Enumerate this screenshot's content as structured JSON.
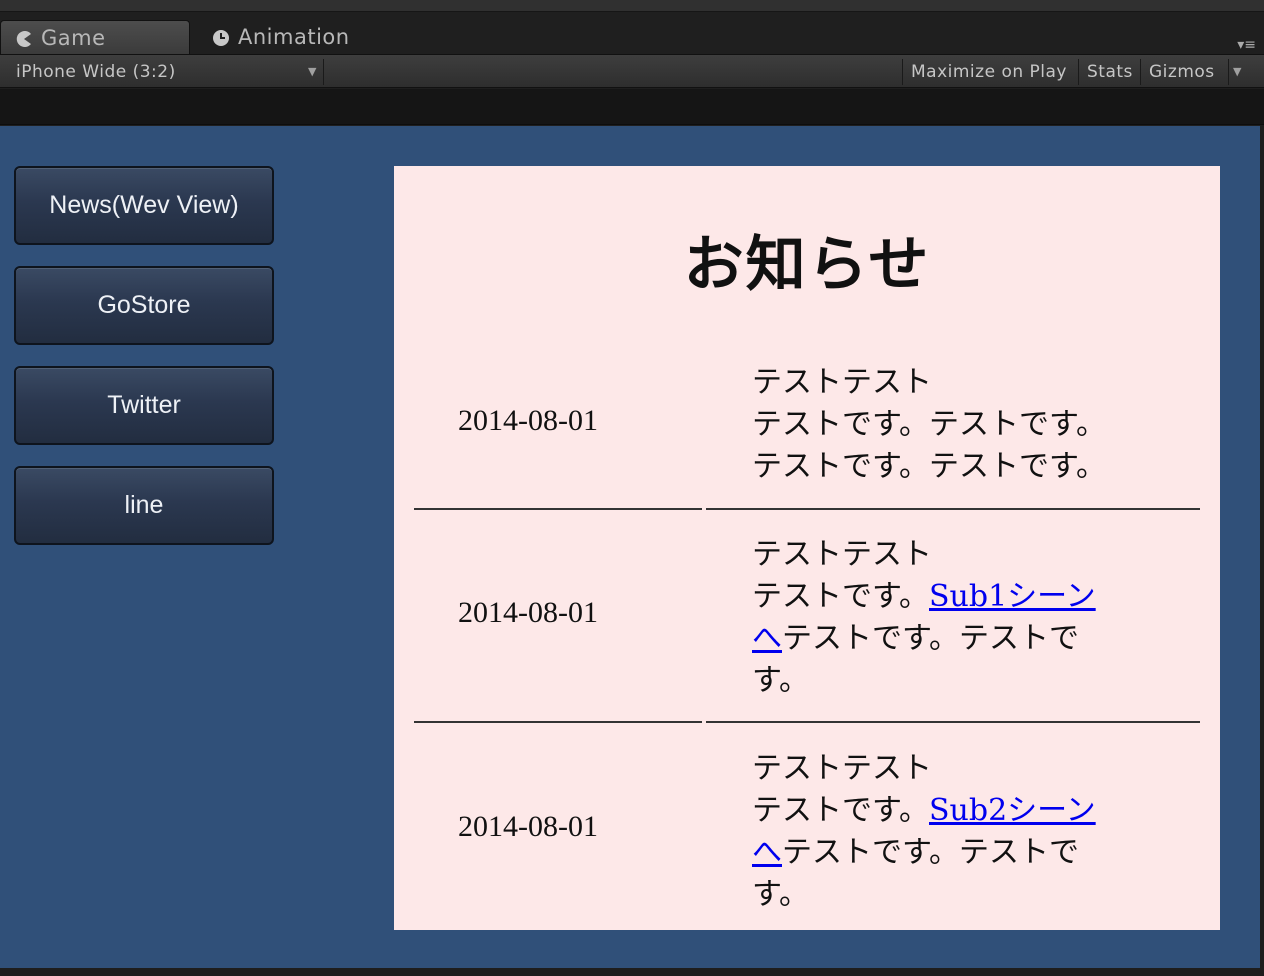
{
  "tabs": [
    {
      "label": "Game",
      "icon": "pacman-icon",
      "active": true
    },
    {
      "label": "Animation",
      "icon": "clock-icon",
      "active": false
    }
  ],
  "toolbar": {
    "aspect_label": "iPhone Wide (3:2)",
    "maximize_label": "Maximize on Play",
    "stats_label": "Stats",
    "gizmos_label": "Gizmos"
  },
  "game_buttons": [
    {
      "label": "News(Wev View)"
    },
    {
      "label": "GoStore"
    },
    {
      "label": "Twitter"
    },
    {
      "label": "line"
    }
  ],
  "webview": {
    "title": "お知らせ",
    "items": [
      {
        "date": "2014-08-01",
        "line1": "テストテスト",
        "line2": "テストです。テストです。",
        "line3": "テストです。テストです。"
      },
      {
        "date": "2014-08-01",
        "line1": "テストテスト",
        "pre": "テストです。",
        "link": "Sub1シーンへ",
        "post": "テストです。テストです。"
      },
      {
        "date": "2014-08-01",
        "line1": "テストテスト",
        "pre": "テストです。",
        "link": "Sub2シーンへ",
        "post": "テストです。テストです。"
      }
    ]
  },
  "colors": {
    "game_background": "#305079",
    "webview_background": "#fde8e8",
    "link": "#0000ee"
  }
}
